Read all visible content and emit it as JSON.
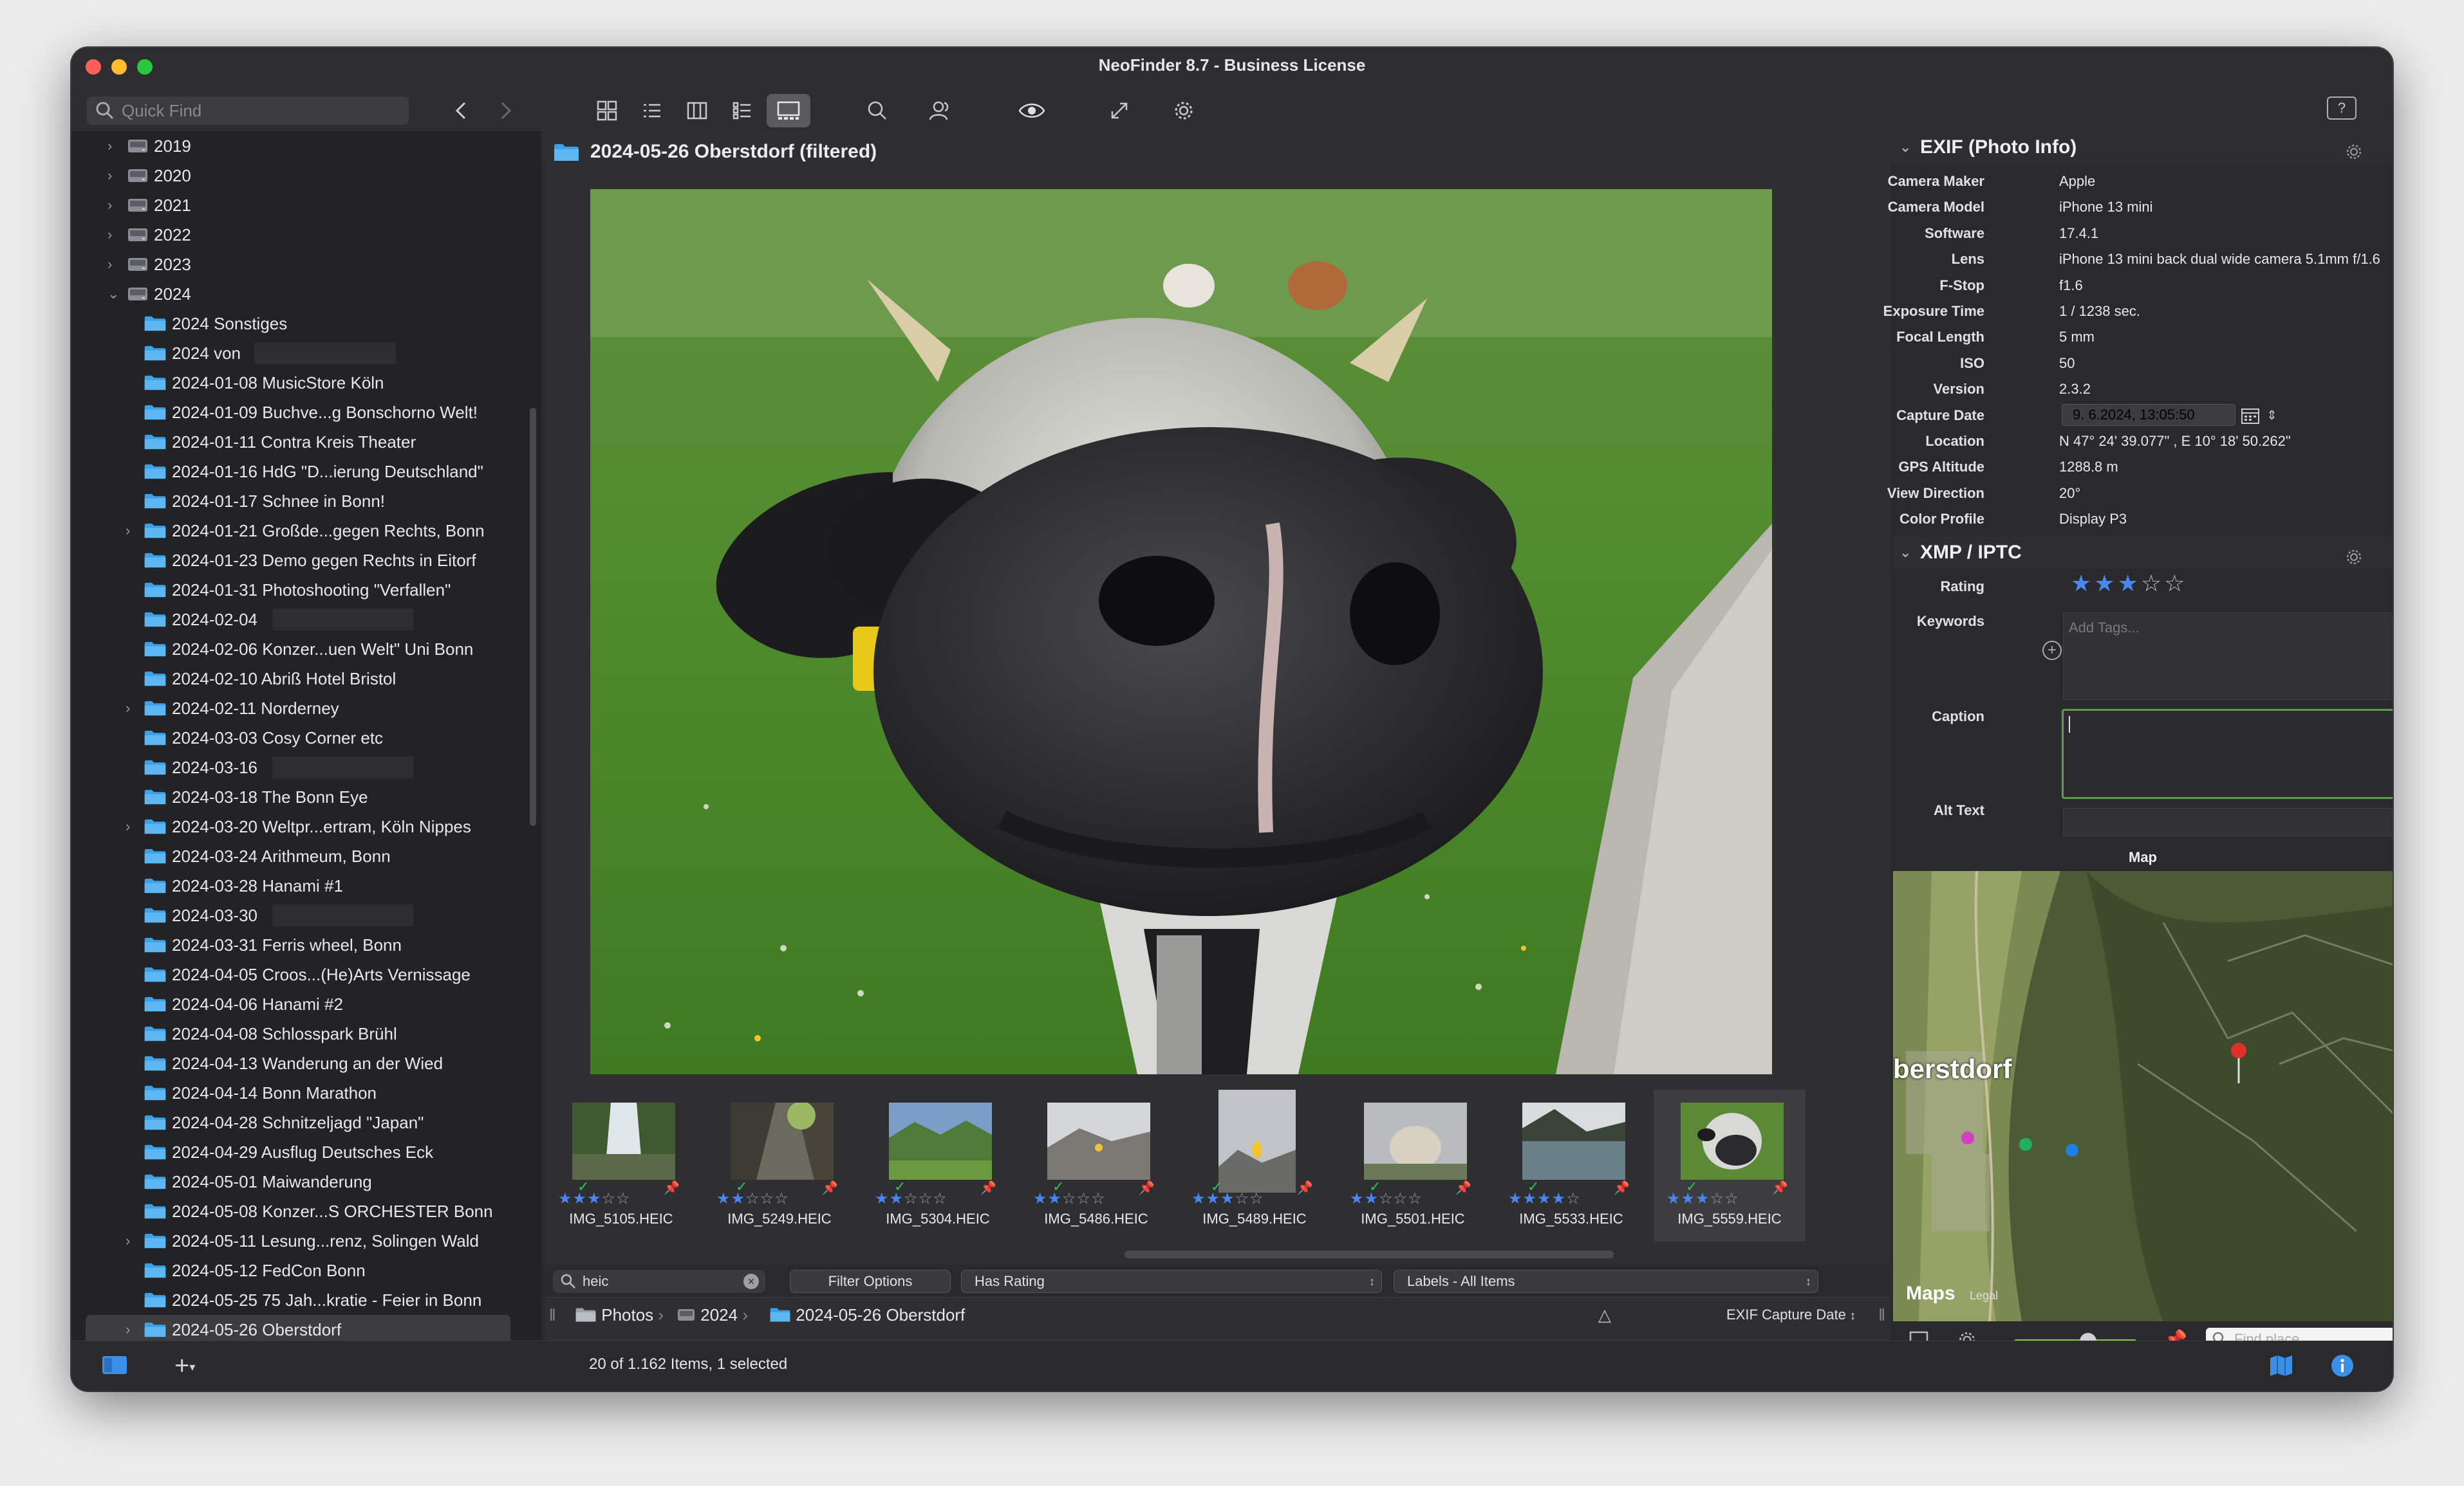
{
  "window": {
    "title": "NeoFinder 8.7 - Business License"
  },
  "toolbar": {
    "quick_find_placeholder": "Quick Find"
  },
  "sidebar": {
    "items": [
      {
        "label": "2019",
        "level": 0,
        "chevron": "right"
      },
      {
        "label": "2020",
        "level": 0,
        "chevron": "right"
      },
      {
        "label": "2021",
        "level": 0,
        "chevron": "right"
      },
      {
        "label": "2022",
        "level": 0,
        "chevron": "right"
      },
      {
        "label": "2023",
        "level": 0,
        "chevron": "right"
      },
      {
        "label": "2024",
        "level": 0,
        "chevron": "down"
      },
      {
        "label": "2024 Sonstiges",
        "level": 1,
        "chevron": ""
      },
      {
        "label": "2024 von",
        "level": 1,
        "chevron": "",
        "redacted": true
      },
      {
        "label": "2024-01-08 MusicStore Köln",
        "level": 1,
        "chevron": ""
      },
      {
        "label": "2024-01-09 Buchve...g Bonschorno Welt!",
        "level": 1,
        "chevron": ""
      },
      {
        "label": "2024-01-11 Contra Kreis Theater",
        "level": 1,
        "chevron": ""
      },
      {
        "label": "2024-01-16 HdG \"D...ierung Deutschland\"",
        "level": 1,
        "chevron": ""
      },
      {
        "label": "2024-01-17 Schnee in Bonn!",
        "level": 1,
        "chevron": ""
      },
      {
        "label": "2024-01-21 Großde...gegen Rechts, Bonn",
        "level": 1,
        "chevron": "right"
      },
      {
        "label": "2024-01-23 Demo gegen Rechts in Eitorf",
        "level": 1,
        "chevron": ""
      },
      {
        "label": "2024-01-31 Photoshooting \"Verfallen\"",
        "level": 1,
        "chevron": ""
      },
      {
        "label": "2024-02-04",
        "level": 1,
        "chevron": "",
        "redacted": true
      },
      {
        "label": "2024-02-06 Konzer...uen Welt\" Uni Bonn",
        "level": 1,
        "chevron": ""
      },
      {
        "label": "2024-02-10 Abriß Hotel Bristol",
        "level": 1,
        "chevron": ""
      },
      {
        "label": "2024-02-11 Norderney",
        "level": 1,
        "chevron": "right"
      },
      {
        "label": "2024-03-03 Cosy Corner etc",
        "level": 1,
        "chevron": ""
      },
      {
        "label": "2024-03-16",
        "level": 1,
        "chevron": "",
        "redacted": true
      },
      {
        "label": "2024-03-18 The Bonn Eye",
        "level": 1,
        "chevron": ""
      },
      {
        "label": "2024-03-20 Weltpr...ertram, Köln Nippes",
        "level": 1,
        "chevron": "right"
      },
      {
        "label": "2024-03-24 Arithmeum, Bonn",
        "level": 1,
        "chevron": ""
      },
      {
        "label": "2024-03-28 Hanami #1",
        "level": 1,
        "chevron": ""
      },
      {
        "label": "2024-03-30",
        "level": 1,
        "chevron": "",
        "redacted": true
      },
      {
        "label": "2024-03-31 Ferris wheel, Bonn",
        "level": 1,
        "chevron": ""
      },
      {
        "label": "2024-04-05 Croos...(He)Arts Vernissage",
        "level": 1,
        "chevron": ""
      },
      {
        "label": "2024-04-06 Hanami #2",
        "level": 1,
        "chevron": ""
      },
      {
        "label": "2024-04-08 Schlosspark Brühl",
        "level": 1,
        "chevron": ""
      },
      {
        "label": "2024-04-13 Wanderung an der Wied",
        "level": 1,
        "chevron": ""
      },
      {
        "label": "2024-04-14 Bonn Marathon",
        "level": 1,
        "chevron": ""
      },
      {
        "label": "2024-04-28 Schnitzeljagd \"Japan\"",
        "level": 1,
        "chevron": ""
      },
      {
        "label": "2024-04-29 Ausflug Deutsches Eck",
        "level": 1,
        "chevron": ""
      },
      {
        "label": "2024-05-01 Maiwanderung",
        "level": 1,
        "chevron": ""
      },
      {
        "label": "2024-05-08 Konzer...S ORCHESTER Bonn",
        "level": 1,
        "chevron": ""
      },
      {
        "label": "2024-05-11 Lesung...renz, Solingen Wald",
        "level": 1,
        "chevron": "right"
      },
      {
        "label": "2024-05-12 FedCon Bonn",
        "level": 1,
        "chevron": ""
      },
      {
        "label": "2024-05-25 75 Jah...kratie - Feier in Bonn",
        "level": 1,
        "chevron": ""
      },
      {
        "label": "2024-05-26 Oberstdorf",
        "level": 1,
        "chevron": "right",
        "selected": true
      }
    ]
  },
  "content": {
    "header_title": "2024-05-26 Oberstdorf  (filtered)",
    "thumbnails": [
      {
        "name": "IMG_5105.HEIC",
        "rating": 3,
        "scene": "waterfall"
      },
      {
        "name": "IMG_5249.HEIC",
        "rating": 2,
        "scene": "gorge"
      },
      {
        "name": "IMG_5304.HEIC",
        "rating": 2,
        "scene": "valley"
      },
      {
        "name": "IMG_5486.HEIC",
        "rating": 2,
        "scene": "rocks"
      },
      {
        "name": "IMG_5489.HEIC",
        "rating": 3,
        "scene": "flower"
      },
      {
        "name": "IMG_5501.HEIC",
        "rating": 2,
        "scene": "goat"
      },
      {
        "name": "IMG_5533.HEIC",
        "rating": 4,
        "scene": "lake"
      },
      {
        "name": "IMG_5559.HEIC",
        "rating": 3,
        "scene": "cow",
        "selected": true
      }
    ]
  },
  "filterbar": {
    "search_value": "heic",
    "filter_options_label": "Filter Options",
    "rating_filter": "Has Rating",
    "labels_filter": "Labels - All Items"
  },
  "pathbar": {
    "items": [
      "Photos",
      "2024",
      "2024-05-26 Oberstdorf"
    ],
    "sort_label": "EXIF Capture Date"
  },
  "status": {
    "text": "20 of 1.162  Items, 1 selected"
  },
  "exif": {
    "title": "EXIF (Photo Info)",
    "rows": [
      {
        "key": "Camera Maker",
        "value": "Apple"
      },
      {
        "key": "Camera Model",
        "value": "iPhone 13 mini"
      },
      {
        "key": "Software",
        "value": "17.4.1"
      },
      {
        "key": "Lens",
        "value": "iPhone 13 mini back dual wide camera 5.1mm f/1.6"
      },
      {
        "key": "F-Stop",
        "value": "f1.6"
      },
      {
        "key": "Exposure Time",
        "value": "1 / 1238 sec."
      },
      {
        "key": "Focal Length",
        "value": "5 mm"
      },
      {
        "key": "ISO",
        "value": "50"
      },
      {
        "key": "Version",
        "value": "2.3.2"
      },
      {
        "key": "Capture Date",
        "value": "9. 6.2024, 13:05:50"
      },
      {
        "key": "Location",
        "value": "N 47° 24' 39.077\" , E 10° 18' 50.262\""
      },
      {
        "key": "GPS Altitude",
        "value": "1288.8 m"
      },
      {
        "key": "View Direction",
        "value": "20°"
      },
      {
        "key": "Color Profile",
        "value": "Display P3"
      }
    ]
  },
  "xmp": {
    "title": "XMP / IPTC",
    "rating_label": "Rating",
    "rating": 3,
    "keywords_label": "Keywords",
    "tags_placeholder": "Add Tags...",
    "caption_label": "Caption",
    "alt_text_label": "Alt Text"
  },
  "map": {
    "label": "Map",
    "town_label": "berstdorf",
    "attribution": "Maps",
    "legal": "Legal",
    "find_placeholder": "Find place"
  },
  "colors": {
    "accent_blue": "#4a86f0",
    "folder_blue": "#3aa0e8",
    "caption_border": "#5f9a52",
    "pin_red": "#e0483c"
  }
}
